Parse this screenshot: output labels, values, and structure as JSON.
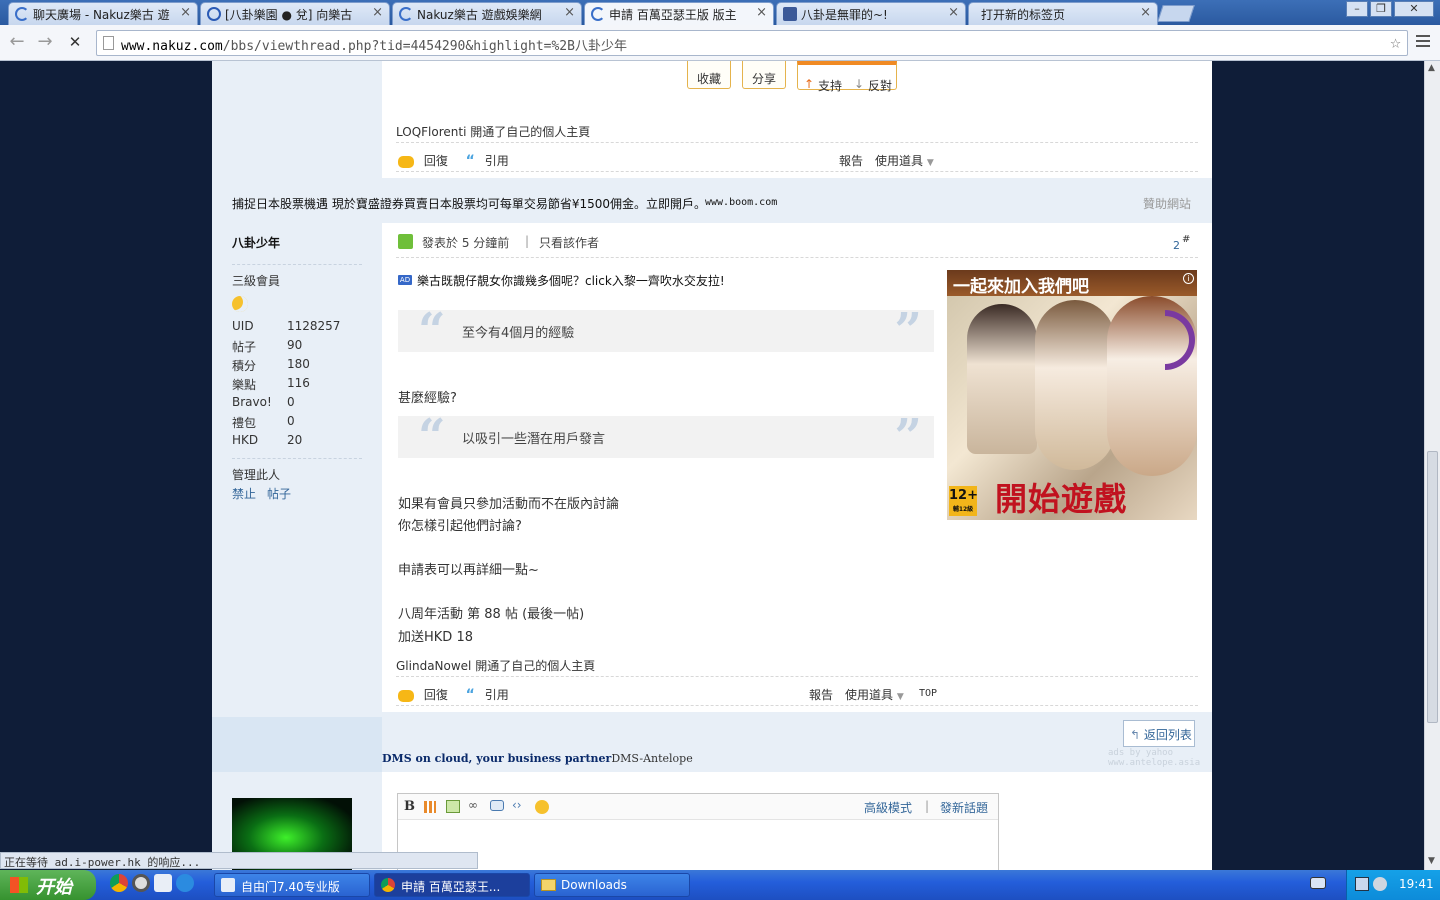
{
  "browser": {
    "tabs": [
      {
        "title": "聊天廣場 - Nakuz樂古 遊",
        "icon_color": "#3a6fc9"
      },
      {
        "title": "[八卦樂園 ● 兌] 向樂古",
        "icon_color": "#2a5ab5"
      },
      {
        "title": "Nakuz樂古 遊戲娛樂網",
        "icon_color": "#3a6fc9"
      },
      {
        "title": "申請 百萬亞瑟王版 版主",
        "icon_color": "#3a6fc9"
      },
      {
        "title": "八卦是無罪的~!",
        "icon_color": "#3b5998"
      },
      {
        "title": "打开新的标签页",
        "icon_color": ""
      }
    ],
    "close_glyph": "×",
    "url_host": "www.nakuz.com",
    "url_path": "/bbs/viewthread.php?tid=4454290&highlight=%2B八卦少年",
    "status_text": "正在等待 ad.i-power.hk 的响应..."
  },
  "post_top": {
    "buttons": {
      "favorite": "收藏",
      "share": "分享",
      "support": "支持",
      "oppose": "反對"
    },
    "activity": "LOQFlorenti 開通了自己的個人主頁",
    "actions": {
      "reply": "回復",
      "quote": "引用",
      "report": "報告",
      "tools": "使用道具"
    }
  },
  "sponsor": {
    "text": "捕捉日本股票機遇 現於寶盛證券買賣日本股票均可每單交易節省¥1500佣金。立即開戶。",
    "url": "www.boom.com",
    "label": "贊助網站"
  },
  "author": {
    "name": "八卦少年",
    "rank": "三級會員",
    "stats": [
      {
        "key": "UID",
        "value": "1128257"
      },
      {
        "key": "帖子",
        "value": "90"
      },
      {
        "key": "積分",
        "value": "180"
      },
      {
        "key": "樂點",
        "value": "116"
      },
      {
        "key": "Bravo!",
        "value": "0"
      },
      {
        "key": "禮包",
        "value": "0"
      },
      {
        "key": "HKD",
        "value": "20"
      }
    ],
    "manage": "管理此人",
    "manage_links": [
      "禁止",
      "帖子"
    ]
  },
  "post": {
    "posted": "發表於 5 分鐘前",
    "separator": "|",
    "only_author": "只看該作者",
    "floor": "2",
    "floor_suffix": "#",
    "ad_badge": "AD",
    "ad_line": "樂古既靚仔靚女你識幾多個呢？click入黎一齊吹水交友拉!",
    "quote1": "至今有4個月的經驗",
    "question": "甚麼經驗?",
    "quote2": "以吸引一些潛在用戶發言",
    "para1": "如果有會員只參加活動而不在版內討論",
    "para2": "你怎樣引起他們討論?",
    "para3": "申請表可以再詳細一點~",
    "para4": "八周年活動 第 88 帖 (最後一帖)",
    "para5": "加送HKD 18",
    "activity": "GlindaNowel 開通了自己的個人主頁",
    "actions": {
      "reply": "回復",
      "quote": "引用",
      "report": "報告",
      "tools": "使用道具",
      "top": "TOP"
    },
    "ad_image": {
      "headline": "一起來加入我們吧",
      "cta": "開始遊戲",
      "rating": "12+",
      "rating_note": "輔12級"
    }
  },
  "footer_bar": {
    "back_to_list": "返回列表",
    "ad_bold": "DMS on cloud, your business partner",
    "ad_rest": "DMS-Antelope",
    "ad_credit1": "ads by yahoo",
    "ad_credit2": "www.antelope.asia"
  },
  "editor": {
    "advanced": "高級模式",
    "separator": "|",
    "new_topic": "發新話題"
  },
  "taskbar": {
    "start": "开始",
    "tasks": [
      "自由门7.40专业版",
      "申請 百萬亞瑟王...",
      "Downloads"
    ],
    "clock": "19:41"
  },
  "colors": {
    "link": "#336699",
    "accent_orange": "#f6b716",
    "sidebar_bg": "#e8eff7",
    "quote_mark": "#c5d3e3"
  }
}
